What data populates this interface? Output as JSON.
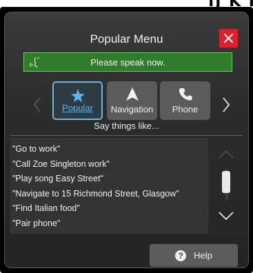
{
  "corner_text": "IJ K I",
  "dialog": {
    "title": "Popular Menu",
    "close_icon": "close-x-icon",
    "close_color": "#d9222d"
  },
  "speak_bar": {
    "text": "Please speak now.",
    "icon": "voice-speaking-icon",
    "color": "#2f7d2b"
  },
  "tabs": [
    {
      "label": "Popular",
      "icon": "star-icon",
      "selected": true
    },
    {
      "label": "Navigation",
      "icon": "navigation-arrow-icon",
      "selected": false
    },
    {
      "label": "Phone",
      "icon": "phone-icon",
      "selected": false
    }
  ],
  "carousel": {
    "left_icon": "chevron-left-icon",
    "right_icon": "chevron-right-icon"
  },
  "say_things": "Say things like...",
  "commands": [
    "\"Go to work\"",
    "\"Call Zoe Singleton work\"",
    "\"Play song Easy Street\"",
    "\"Navigate to 15 Richmond Street, Glasgow\"",
    "\"Find Italian food\"",
    "\"Pair phone\""
  ],
  "scroll": {
    "up_icon": "chevron-up-icon",
    "down_icon": "chevron-down-icon"
  },
  "help": {
    "label": "Help",
    "icon": "question-mark-icon",
    "icon_text": "?"
  },
  "accent_color": "#6fb6dd"
}
